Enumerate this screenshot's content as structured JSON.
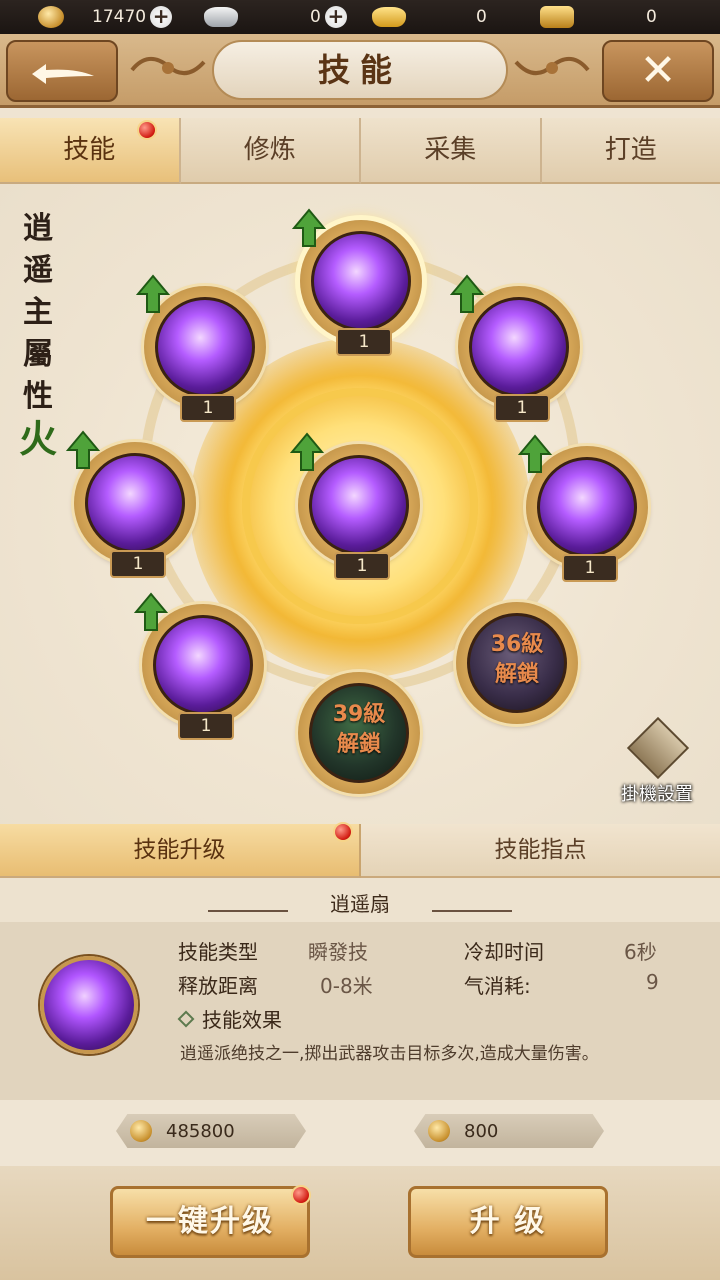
{
  "resources": {
    "coins": "17470",
    "silver": "0",
    "gold": "0",
    "bag": "0"
  },
  "header": {
    "title": "技能"
  },
  "tabs": [
    {
      "label": "技能",
      "active": true,
      "badge": true
    },
    {
      "label": "修炼",
      "active": false,
      "badge": false
    },
    {
      "label": "采集",
      "active": false,
      "badge": false
    },
    {
      "label": "打造",
      "active": false,
      "badge": false
    }
  ],
  "side_label": {
    "chars": [
      "逍",
      "遥",
      "主",
      "屬",
      "性"
    ],
    "element": "火"
  },
  "skills": [
    {
      "id": "top",
      "level": "1",
      "selected": true,
      "upgradable": true
    },
    {
      "id": "upper-left",
      "level": "1",
      "upgradable": true
    },
    {
      "id": "upper-right",
      "level": "1",
      "upgradable": true
    },
    {
      "id": "left",
      "level": "1",
      "upgradable": true
    },
    {
      "id": "center",
      "level": "1",
      "upgradable": true
    },
    {
      "id": "right",
      "level": "1",
      "upgradable": true
    },
    {
      "id": "lower-left",
      "level": "1",
      "upgradable": true
    },
    {
      "id": "lower-right",
      "locked_text": "36級\n解鎖"
    },
    {
      "id": "bottom",
      "locked_text": "39級\n解鎖"
    }
  ],
  "locked": {
    "lower_right_line1": "36級",
    "lower_right_line2": "解鎖",
    "bottom_line1": "39級",
    "bottom_line2": "解鎖"
  },
  "idle_settings": {
    "label": "掛機設置"
  },
  "subtabs": [
    {
      "label": "技能升级",
      "active": true,
      "badge": true
    },
    {
      "label": "技能指点",
      "active": false
    }
  ],
  "detail": {
    "skill_name": "逍遥扇",
    "type_label": "技能类型",
    "type_value": "瞬發技",
    "cooldown_label": "冷却时间",
    "cooldown_value": "6秒",
    "range_label": "释放距离",
    "range_value": "0-8米",
    "qi_label": "气消耗:",
    "qi_value": "9",
    "effect_title": "技能效果",
    "description": "逍遥派绝技之一,掷出武器攻击目标多次,造成大量伤害。"
  },
  "costs": {
    "cost1": "485800",
    "cost2": "800"
  },
  "buttons": {
    "one_click": "一键升级",
    "upgrade": "升 级"
  }
}
